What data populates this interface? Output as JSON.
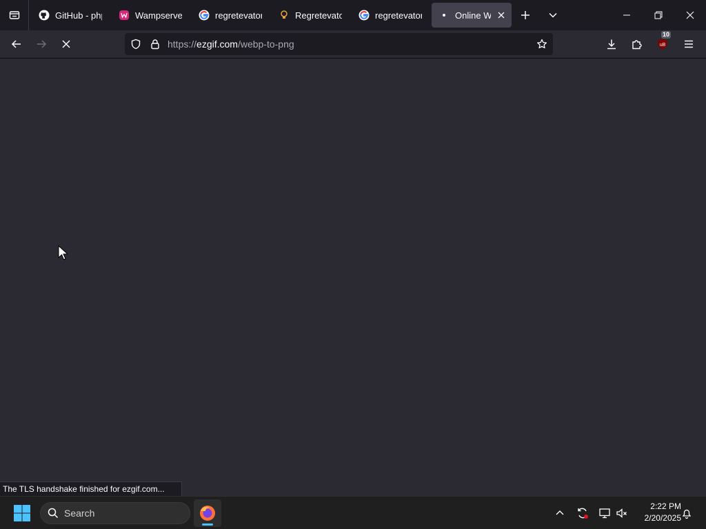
{
  "tabs": [
    {
      "label": "GitHub - phps",
      "icon": "github-icon"
    },
    {
      "label": "Wampserver -",
      "icon": "wampserver-icon"
    },
    {
      "label": "regretevator se",
      "icon": "google-icon"
    },
    {
      "label": "Regretevator (",
      "icon": "bulb-icon"
    },
    {
      "label": "regretevator w",
      "icon": "google-icon"
    },
    {
      "label": "Online Web",
      "icon": "loading-dot-icon",
      "active": true
    }
  ],
  "address": {
    "scheme": "https://",
    "host": "ezgif.com",
    "path": "/webp-to-png"
  },
  "extension_badge": "10",
  "status_text": "The TLS handshake finished for ezgif.com...",
  "taskbar": {
    "search_label": "Search",
    "time": "2:22 PM",
    "date": "2/20/2025"
  },
  "colors": {
    "tabbar_bg": "#1c1b22",
    "toolbar_bg": "#2b2a33",
    "active_tab": "#42414d",
    "taskbar_bg": "#1f1f1f",
    "windows_accent": "#4cc2ff"
  }
}
